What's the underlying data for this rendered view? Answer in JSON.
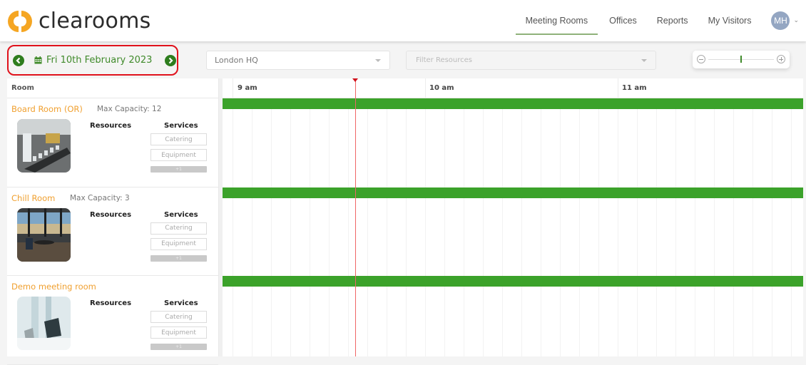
{
  "header": {
    "brand": "clearooms",
    "brand_color": "#f5a623",
    "nav": [
      {
        "label": "Meeting Rooms",
        "active": true
      },
      {
        "label": "Offices",
        "active": false
      },
      {
        "label": "Reports",
        "active": false
      },
      {
        "label": "My Visitors",
        "active": false
      }
    ],
    "user_initials": "MH",
    "user_menu_icon": "chevron-down-icon"
  },
  "toolbar": {
    "date_label": "Fri 10th February 2023",
    "prev_icon": "chevron-left-circle-icon",
    "next_icon": "chevron-right-circle-icon",
    "calendar_icon": "calendar-icon",
    "location_value": "London HQ",
    "filter_placeholder": "Filter Resources",
    "zoom_level": 0.5,
    "accent_color": "#3f8a2a",
    "highlight_color": "#e0121c"
  },
  "grid": {
    "room_header": "Room",
    "hours": [
      "9 am",
      "10 am",
      "11 am"
    ],
    "booking_color": "#3ba22a",
    "now_line_color": "#ef6666"
  },
  "rooms": [
    {
      "name": "Board Room (OR)",
      "capacity": "Max Capacity: 12",
      "resources_label": "Resources",
      "services_label": "Services",
      "services": [
        "Catering",
        "Equipment"
      ],
      "more": "+1",
      "image": "boardroom-photo"
    },
    {
      "name": "Chill Room",
      "capacity": "Max Capacity: 3",
      "resources_label": "Resources",
      "services_label": "Services",
      "services": [
        "Catering",
        "Equipment"
      ],
      "more": "+1",
      "image": "lounge-photo"
    },
    {
      "name": "Demo meeting room",
      "capacity": "",
      "resources_label": "Resources",
      "services_label": "Services",
      "services": [
        "Catering",
        "Equipment"
      ],
      "more": "+1",
      "image": "meeting-room-photo"
    }
  ]
}
